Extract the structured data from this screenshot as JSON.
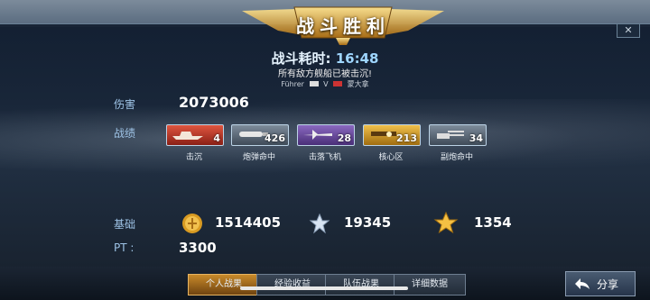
{
  "banner": {
    "title": "战斗胜利"
  },
  "battle": {
    "duration_label": "战斗耗时:",
    "duration": "16:48",
    "subtitle": "所有敌方舰船已被击沉!",
    "player_left": "Führer",
    "vs": "V",
    "player_right": "蒙大拿"
  },
  "damage": {
    "label": "伤害",
    "value": "2073006"
  },
  "achievements": {
    "label": "战绩",
    "items": [
      {
        "label": "击沉",
        "count": "4",
        "color": "#c0392b",
        "icon": "ship-icon"
      },
      {
        "label": "炮弹命中",
        "count": "426",
        "color": "#5c6b7c",
        "icon": "shell-icon"
      },
      {
        "label": "击落飞机",
        "count": "28",
        "color": "#6c4a9a",
        "icon": "plane-icon"
      },
      {
        "label": "核心区",
        "count": "213",
        "color": "#d49b1c",
        "icon": "core-icon"
      },
      {
        "label": "副炮命中",
        "count": "34",
        "color": "#5c6b7c",
        "icon": "turret-icon"
      }
    ]
  },
  "base": {
    "label": "基础",
    "coins": "1514405",
    "silver_star": "19345",
    "gold_star": "1354"
  },
  "pt": {
    "label": "PT :",
    "value": "3300"
  },
  "tabs": [
    {
      "label": "个人战果",
      "active": true
    },
    {
      "label": "经验收益",
      "active": false
    },
    {
      "label": "队伍战果",
      "active": false
    },
    {
      "label": "详细数据",
      "active": false
    }
  ],
  "share": {
    "label": "分享"
  },
  "close": {
    "label": "✕"
  }
}
